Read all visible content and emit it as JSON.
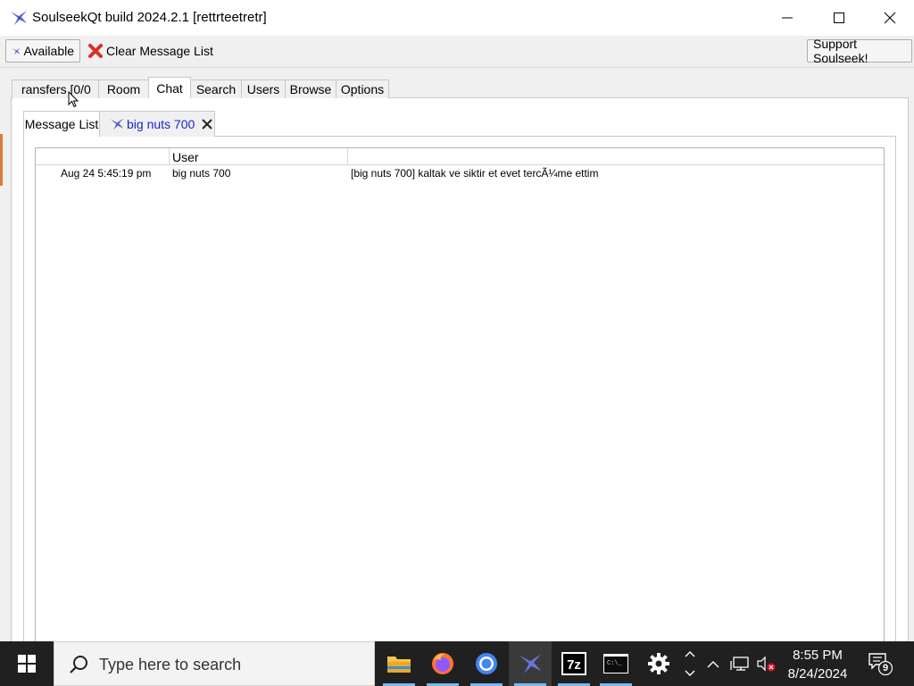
{
  "window": {
    "title": "SoulseekQt build 2024.2.1 [rettrteetretr]"
  },
  "toolbar": {
    "available_label": "Available",
    "clear_label": "Clear Message List",
    "support_label": "Support Soulseek!"
  },
  "tabs": [
    {
      "label": "ransfers [0/0"
    },
    {
      "label": "Room"
    },
    {
      "label": "Chat"
    },
    {
      "label": "Search"
    },
    {
      "label": "Users"
    },
    {
      "label": "Browse"
    },
    {
      "label": "Options"
    }
  ],
  "subtabs": [
    {
      "label": "Message List"
    },
    {
      "label": "big nuts 700"
    }
  ],
  "table": {
    "columns": [
      "",
      "User",
      ""
    ],
    "rows": [
      {
        "time": "Aug 24 5:45:19 pm",
        "user": "big nuts 700",
        "message": "[big nuts 700] kaltak ve siktir et evet tercÃ¼me ettim"
      }
    ]
  },
  "taskbar": {
    "search_placeholder": "Type here to search",
    "time": "8:55 PM",
    "date": "8/24/2024",
    "notification_count": "9"
  }
}
